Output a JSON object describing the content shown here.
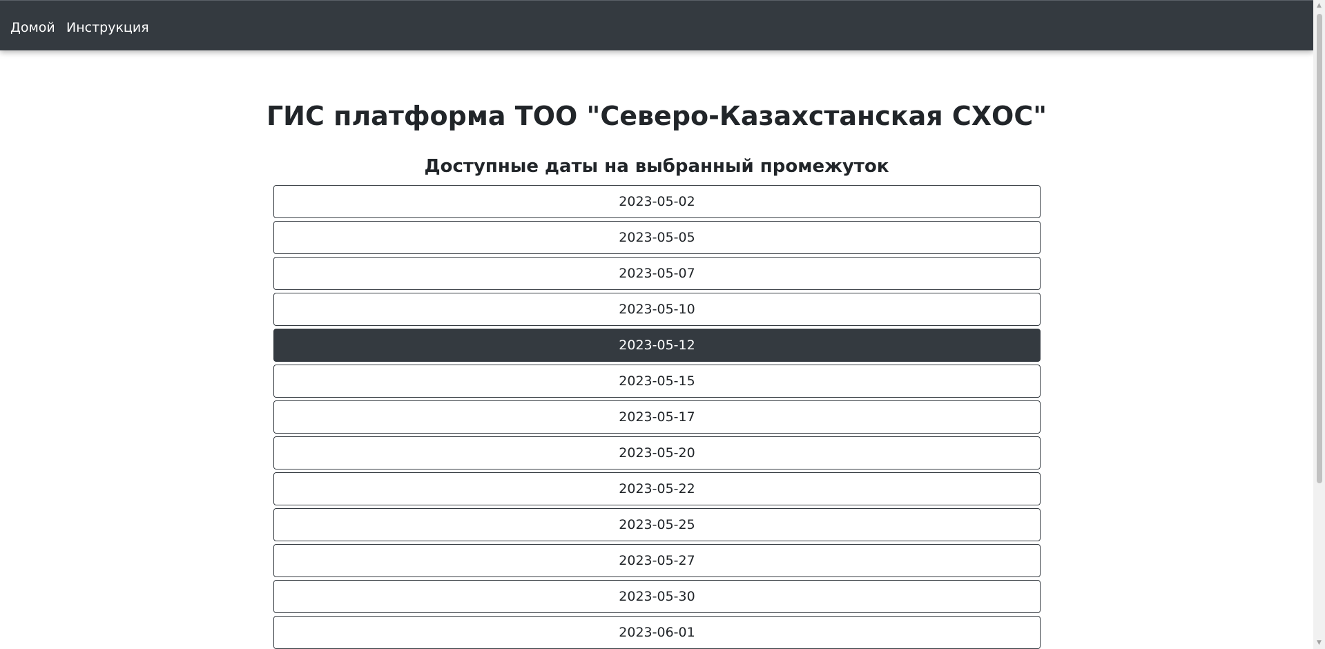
{
  "nav": {
    "home_label": "Домой",
    "instructions_label": "Инструкция"
  },
  "main": {
    "title": "ГИС платформа ТОО \"Северо-Казахстанская СХОС\"",
    "subtitle": "Доступные даты на выбранный промежуток"
  },
  "dates": [
    {
      "label": "2023-05-02",
      "active": false
    },
    {
      "label": "2023-05-05",
      "active": false
    },
    {
      "label": "2023-05-07",
      "active": false
    },
    {
      "label": "2023-05-10",
      "active": false
    },
    {
      "label": "2023-05-12",
      "active": true
    },
    {
      "label": "2023-05-15",
      "active": false
    },
    {
      "label": "2023-05-17",
      "active": false
    },
    {
      "label": "2023-05-20",
      "active": false
    },
    {
      "label": "2023-05-22",
      "active": false
    },
    {
      "label": "2023-05-25",
      "active": false
    },
    {
      "label": "2023-05-27",
      "active": false
    },
    {
      "label": "2023-05-30",
      "active": false
    },
    {
      "label": "2023-06-01",
      "active": false
    }
  ],
  "colors": {
    "navbar_bg": "#343a40",
    "active_bg": "#343a40",
    "text": "#212529"
  },
  "icons": {
    "scroll_up": "▲",
    "scroll_down": "▼"
  }
}
